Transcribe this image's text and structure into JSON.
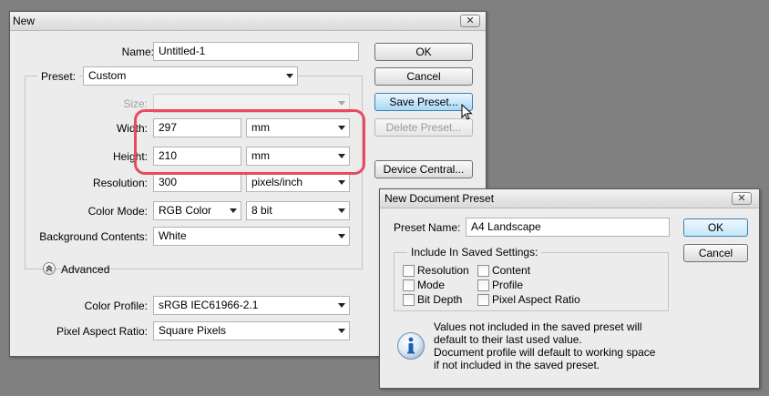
{
  "new_dialog": {
    "title": "New",
    "close_glyph": "✕",
    "name_label": "Name:",
    "name_value": "Untitled-1",
    "preset_label": "Preset:",
    "preset_value": "Custom",
    "size_label": "Size:",
    "size_value": "",
    "width_label": "Width:",
    "width_value": "297",
    "width_unit": "mm",
    "height_label": "Height:",
    "height_value": "210",
    "height_unit": "mm",
    "resolution_label": "Resolution:",
    "resolution_value": "300",
    "resolution_unit": "pixels/inch",
    "color_mode_label": "Color Mode:",
    "color_mode_value": "RGB Color",
    "bit_depth_value": "8 bit",
    "background_label": "Background Contents:",
    "background_value": "White",
    "advanced_label": "Advanced",
    "advanced_icon": "collapse-chevrons-icon",
    "color_profile_label": "Color Profile:",
    "color_profile_value": "sRGB IEC61966-2.1",
    "pixel_aspect_label": "Pixel Aspect Ratio:",
    "pixel_aspect_value": "Square Pixels",
    "buttons": {
      "ok": "OK",
      "cancel": "Cancel",
      "save_preset": "Save Preset...",
      "delete_preset": "Delete Preset...",
      "device_central": "Device Central..."
    },
    "highlight_color": "#e94a5f"
  },
  "preset_dialog": {
    "title": "New Document Preset",
    "close_glyph": "✕",
    "preset_name_label": "Preset Name:",
    "preset_name_value": "A4 Landscape",
    "ok": "OK",
    "cancel": "Cancel",
    "include_label": "Include In Saved Settings:",
    "checkboxes": {
      "resolution": "Resolution",
      "mode": "Mode",
      "bit_depth": "Bit Depth",
      "content": "Content",
      "profile": "Profile",
      "pixel_aspect_ratio": "Pixel Aspect Ratio"
    },
    "info_icon": "info-icon",
    "info_line1": "Values not included in the saved preset will",
    "info_line2": "default to their last used value.",
    "info_line3": "Document profile will default to working space",
    "info_line4": "if not included in the saved preset."
  },
  "colors": {
    "desktop": "#808080",
    "dialog_bg": "#ececec",
    "button_hover": "#a7d9f5",
    "info_blue": "#1f5fb4"
  }
}
